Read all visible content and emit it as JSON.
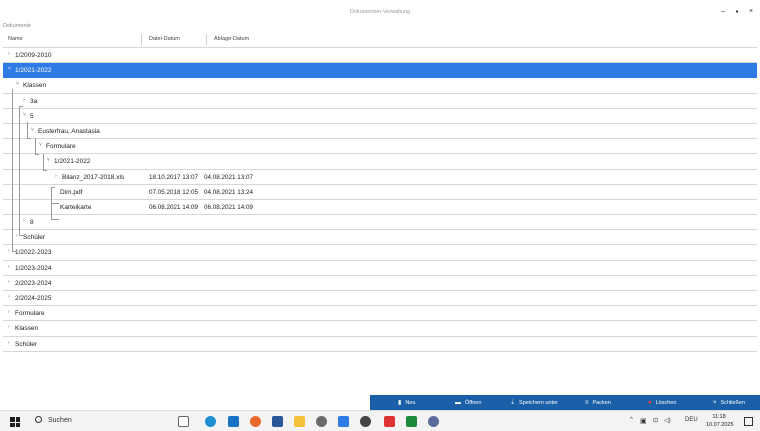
{
  "window": {
    "title": "Dokumenten-Verwaltung",
    "section_label": "Dokumente",
    "controls": {
      "minimize": "–",
      "maximize": "▪",
      "close": "×"
    }
  },
  "table": {
    "columns": [
      "Name",
      "Datei-Datum",
      "Ablage-Datum"
    ],
    "rows": [
      {
        "label": "1/2009-2010",
        "expander": "›",
        "d1": "",
        "d2": ""
      },
      {
        "label": "1/2021-2022",
        "expander": "˅",
        "d1": "",
        "d2": ""
      },
      {
        "label": "Klassen",
        "expander": "˅",
        "d1": "",
        "d2": ""
      },
      {
        "label": "3a",
        "expander": "›",
        "d1": "",
        "d2": ""
      },
      {
        "label": "5",
        "expander": "˅",
        "d1": "",
        "d2": ""
      },
      {
        "label": "Eusterfrau, Anastasia",
        "expander": "˅",
        "d1": "",
        "d2": ""
      },
      {
        "label": "Formulare",
        "expander": "˅",
        "d1": "",
        "d2": ""
      },
      {
        "label": "1/2021-2022",
        "expander": "˅",
        "d1": "",
        "d2": ""
      },
      {
        "label": "Bilanz_2017-2018.xls",
        "expander": "›",
        "d1": "18.10.2017 13:07",
        "d2": "04.08.2021 13:07"
      },
      {
        "label": "Dim.pdf",
        "expander": "",
        "d1": "07.05.2018 12:05",
        "d2": "04.08.2021 13:24"
      },
      {
        "label": "Karteikarte",
        "expander": "",
        "d1": "06.08.2021 14:09",
        "d2": "06.08.2021 14:09"
      },
      {
        "label": "8",
        "expander": "›",
        "d1": "",
        "d2": ""
      },
      {
        "label": "Schüler",
        "expander": "›",
        "d1": "",
        "d2": ""
      },
      {
        "label": "1/2022-2023",
        "expander": "›",
        "d1": "",
        "d2": ""
      },
      {
        "label": "1/2023-2024",
        "expander": "›",
        "d1": "",
        "d2": ""
      },
      {
        "label": "2/2023-2024",
        "expander": "›",
        "d1": "",
        "d2": ""
      },
      {
        "label": "2/2024-2025",
        "expander": "›",
        "d1": "",
        "d2": ""
      },
      {
        "label": "Formulare",
        "expander": "›",
        "d1": "",
        "d2": ""
      },
      {
        "label": "Klassen",
        "expander": "›",
        "d1": "",
        "d2": ""
      },
      {
        "label": "Schüler",
        "expander": "›",
        "d1": "",
        "d2": ""
      }
    ]
  },
  "actions": [
    {
      "label": "Neu",
      "icon": "new-document-icon"
    },
    {
      "label": "Öffnen",
      "icon": "folder-open-icon"
    },
    {
      "label": "Speichern unter",
      "icon": "save-as-icon"
    },
    {
      "label": "Packen",
      "icon": "pack-icon"
    },
    {
      "label": "Löschen",
      "icon": "delete-icon"
    },
    {
      "label": "Schließen",
      "icon": "close-icon"
    }
  ],
  "taskbar": {
    "search_label": "Suchen",
    "language": "DEU",
    "time": "11:18",
    "date": "10.07.2025"
  },
  "colors": {
    "selection": "#2f7be6",
    "action_bar": "#1b5fa8"
  }
}
